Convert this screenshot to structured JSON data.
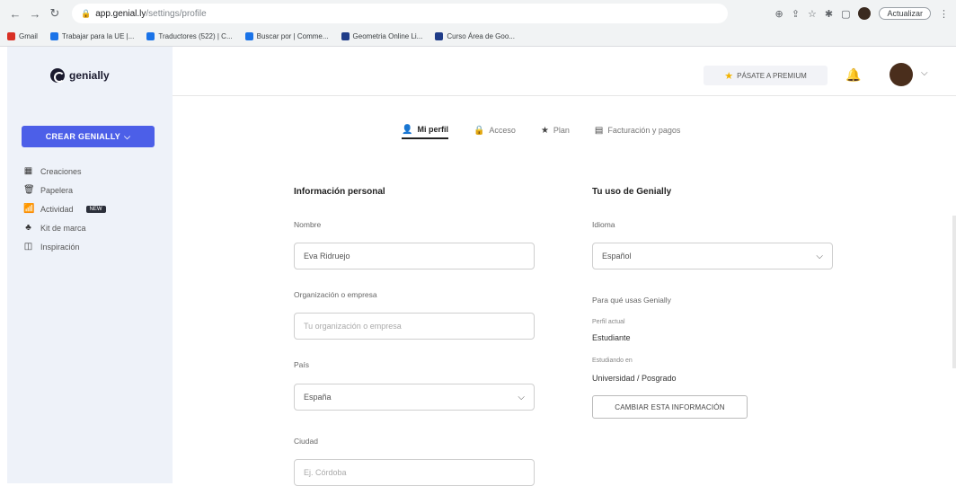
{
  "browser": {
    "url_host": "app.genial.ly",
    "url_path": "/settings/profile",
    "update_label": "Actualizar",
    "bookmarks": [
      {
        "label": "Gmail",
        "color": "#d93025"
      },
      {
        "label": "Trabajar para la UE |...",
        "color": "#1a73e8"
      },
      {
        "label": "Traductores (522) | C...",
        "color": "#1a73e8"
      },
      {
        "label": "Buscar por | Comme...",
        "color": "#1a73e8"
      },
      {
        "label": "Geometria Online Li...",
        "color": "#1f3c88"
      },
      {
        "label": "Curso Área de Goo...",
        "color": "#1f3c88"
      }
    ]
  },
  "app": {
    "logo_text": "genially",
    "create_label": "CREAR GENIALLY",
    "sidebar": [
      {
        "icon": "grid-icon",
        "glyph": "▦",
        "label": "Creaciones"
      },
      {
        "icon": "trash-icon",
        "glyph": "🗑",
        "label": "Papelera"
      },
      {
        "icon": "activity-icon",
        "glyph": "📶",
        "label": "Actividad",
        "badge": "NEW"
      },
      {
        "icon": "brand-kit-icon",
        "glyph": "♣",
        "label": "Kit de marca"
      },
      {
        "icon": "inspiration-icon",
        "glyph": "◫",
        "label": "Inspiración"
      }
    ],
    "premium_label": "PÁSATE A PREMIUM",
    "accent": "#4c5fe8"
  },
  "tabs": [
    {
      "icon": "user-icon",
      "glyph": "👤",
      "label": "Mi perfil",
      "active": true
    },
    {
      "icon": "lock-icon",
      "glyph": "🔒",
      "label": "Acceso"
    },
    {
      "icon": "star-icon",
      "glyph": "★",
      "label": "Plan"
    },
    {
      "icon": "receipt-icon",
      "glyph": "▤",
      "label": "Facturación y pagos"
    }
  ],
  "personal": {
    "title": "Información personal",
    "name_label": "Nombre",
    "name_value": "Eva Ridruejo",
    "org_label": "Organización o empresa",
    "org_placeholder": "Tu organización o empresa",
    "country_label": "País",
    "country_value": "España",
    "city_label": "Ciudad",
    "city_placeholder": "Ej. Córdoba"
  },
  "usage": {
    "title": "Tu uso de Genially",
    "language_label": "Idioma",
    "language_value": "Español",
    "purpose_label": "Para qué usas Genially",
    "profile_label": "Perfil actual",
    "profile_value": "Estudiante",
    "level_label": "Estudiando en",
    "level_value": "Universidad / Posgrado",
    "change_label": "CAMBIAR ESTA INFORMACIÓN"
  }
}
